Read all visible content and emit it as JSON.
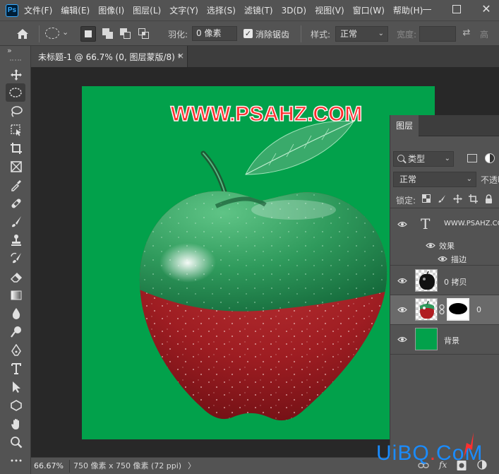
{
  "app": {
    "logo_text": "Ps"
  },
  "menu": [
    "文件(F)",
    "编辑(E)",
    "图像(I)",
    "图层(L)",
    "文字(Y)",
    "选择(S)",
    "滤镜(T)",
    "3D(D)",
    "视图(V)",
    "窗口(W)",
    "帮助(H)"
  ],
  "options_bar": {
    "feather_label": "羽化:",
    "feather_value": "0 像素",
    "anti_alias_label": "消除锯齿",
    "anti_alias_checked": true,
    "style_label": "样式:",
    "style_value": "正常",
    "width_label": "宽度:",
    "height_label": "高"
  },
  "document_tab": {
    "title": "未标题-1 @ 66.7% (0, 图层蒙版/8) *",
    "close_glyph": "×"
  },
  "canvas": {
    "background_color": "#02a14b",
    "watermark_text": "WWW.PSAHZ.COM"
  },
  "layers_panel": {
    "tab_label": "图层",
    "filter_label": "类型",
    "blend_mode": "正常",
    "opacity_label": "不透明",
    "lock_label": "锁定:",
    "layers": [
      {
        "name": "WWW.PSAHZ.CO",
        "type": "text",
        "thumb_glyph": "T",
        "visible": true
      },
      {
        "name": "效果",
        "type": "effects",
        "visible": true
      },
      {
        "name": "描边",
        "type": "effect-stroke",
        "visible": true
      },
      {
        "name": "0 拷贝",
        "type": "image",
        "visible": true
      },
      {
        "name": "0",
        "type": "image-with-mask",
        "visible": true,
        "selected": true
      },
      {
        "name": "背景",
        "type": "fill",
        "visible": true
      }
    ]
  },
  "status_bar": {
    "zoom": "66.67%",
    "doc_info": "750 像素 x 750 像素 (72 ppi)",
    "arrow_glyph": "〉"
  },
  "site_watermark": {
    "text_before_dot": "UiBQ",
    "dot": ".",
    "text_after_dot": "CoM"
  },
  "colors": {
    "accent_blue": "#1a8cff",
    "watermark_red": "#ff2b2b",
    "canvas_green": "#02a14b"
  }
}
